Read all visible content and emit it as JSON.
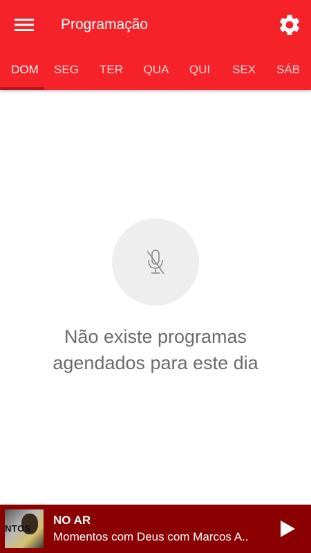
{
  "header": {
    "title": "Programação",
    "menu_icon": "hamburger-menu-icon",
    "settings_icon": "gear-icon"
  },
  "tabs": [
    {
      "label": "DOM",
      "active": true
    },
    {
      "label": "SEG",
      "active": false
    },
    {
      "label": "TER",
      "active": false
    },
    {
      "label": "QUA",
      "active": false
    },
    {
      "label": "QUI",
      "active": false
    },
    {
      "label": "SEX",
      "active": false
    },
    {
      "label": "SÁB",
      "active": false
    }
  ],
  "empty_state": {
    "icon": "microphone-off-icon",
    "message_line1": "Não existe programas",
    "message_line2": "agendados para este dia"
  },
  "player": {
    "status_label": "NO AR",
    "program_title": "Momentos com Deus com Marcos A..",
    "thumbnail_text": "NTOS",
    "play_icon": "play-icon"
  },
  "colors": {
    "primary": "#f5222a",
    "player_background": "#8b0000",
    "text_muted": "#6b6b6b"
  }
}
